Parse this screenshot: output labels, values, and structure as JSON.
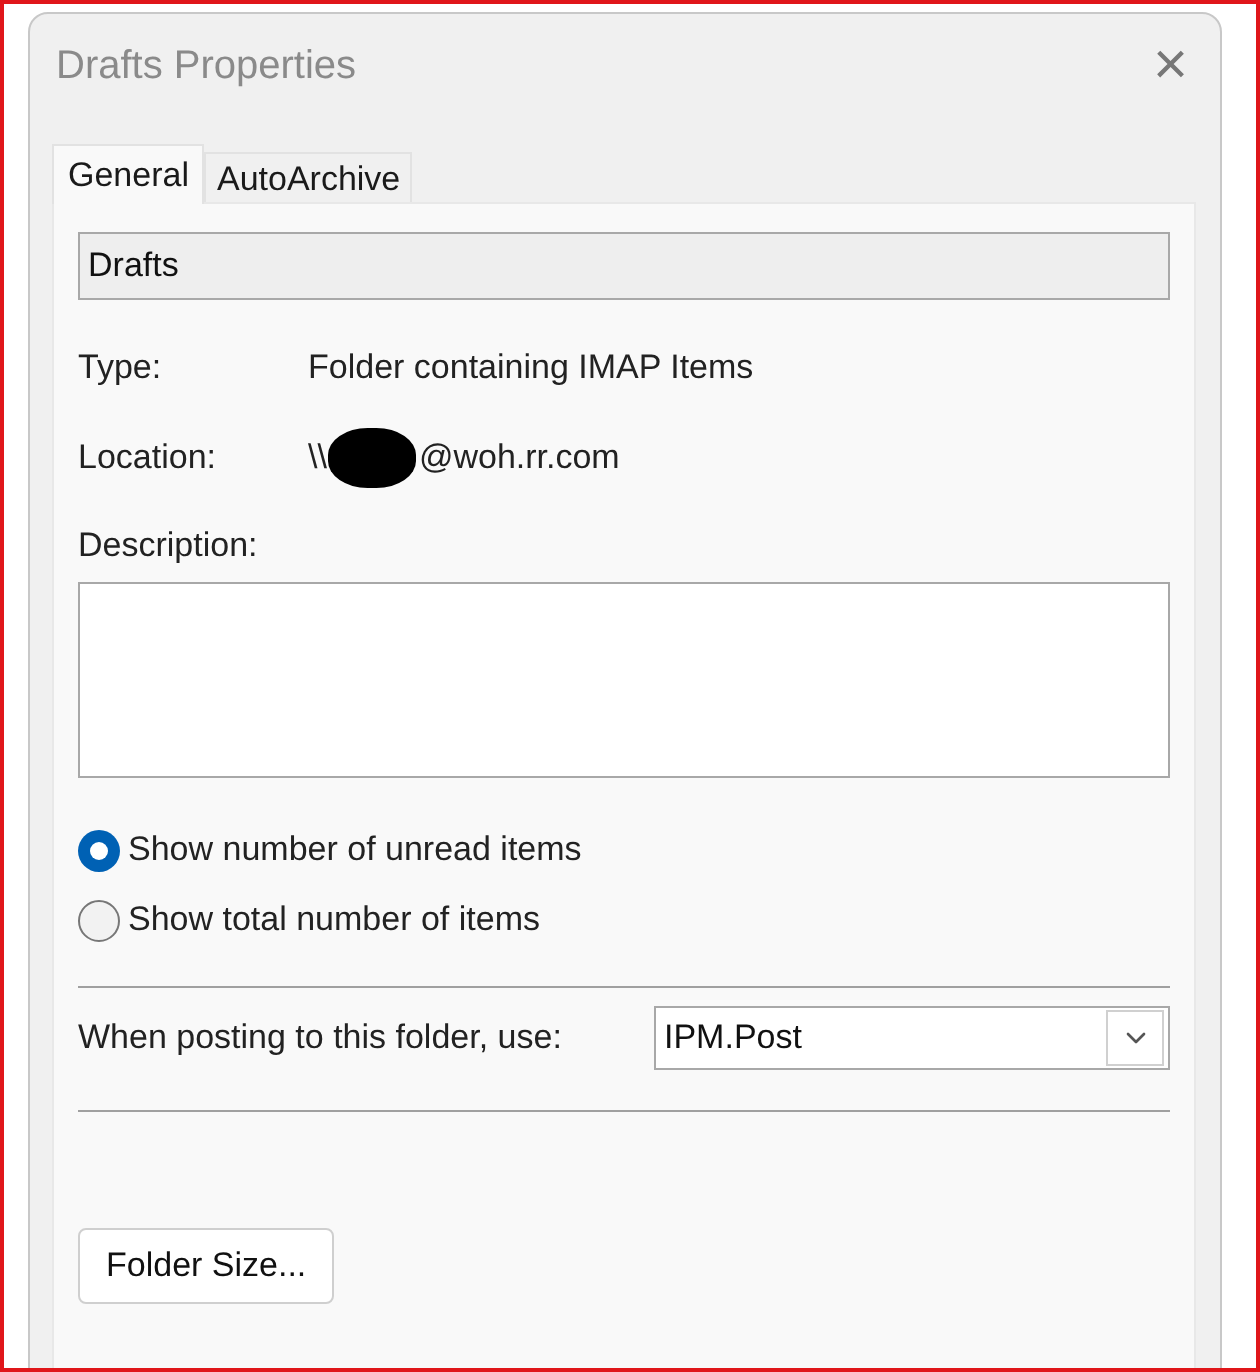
{
  "window": {
    "title": "Drafts Properties",
    "close": "×"
  },
  "tabs": [
    {
      "label": "General",
      "selected": true
    },
    {
      "label": "AutoArchive",
      "selected": false
    }
  ],
  "name_field": {
    "value": "Drafts"
  },
  "type": {
    "label": "Type:",
    "value": "Folder containing IMAP Items"
  },
  "location": {
    "label": "Location:",
    "value_start": "\\\\",
    "value_end": "@woh.rr.com",
    "redacted": true
  },
  "description": {
    "label": "Description:"
  },
  "count_options": [
    {
      "label": "Show number of unread items",
      "selected": true
    },
    {
      "label": "Show total number of items",
      "selected": false
    }
  ],
  "posting": {
    "label": "When posting to this folder, use:",
    "value": "IPM.Post"
  },
  "buttons": [
    "Folder Size..."
  ]
}
